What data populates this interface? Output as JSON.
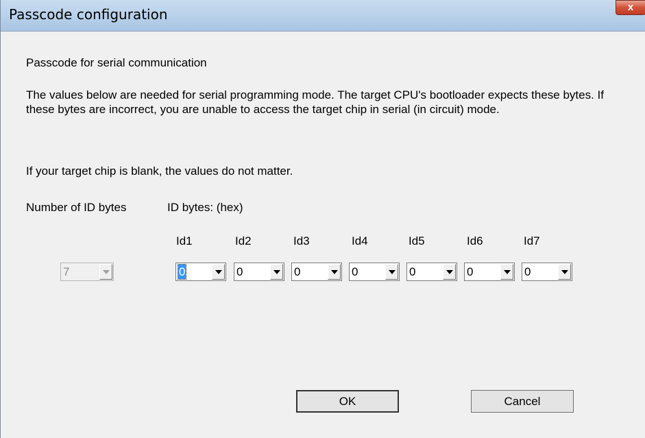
{
  "window": {
    "title": "Passcode configuration",
    "close_label": "x"
  },
  "heading": "Passcode for serial communication",
  "description": "The values below are needed for serial programming mode. The target CPU's bootloader expects these bytes. If these bytes are incorrect, you are unable to access the target chip in serial (in circuit) mode.",
  "note": "If your target chip is blank, the values do not matter.",
  "num_bytes": {
    "label": "Number of ID bytes",
    "value": "7",
    "enabled": false
  },
  "id_bytes": {
    "label": "ID bytes: (hex)",
    "fields": [
      {
        "label": "Id1",
        "value": "0"
      },
      {
        "label": "Id2",
        "value": "0"
      },
      {
        "label": "Id3",
        "value": "0"
      },
      {
        "label": "Id4",
        "value": "0"
      },
      {
        "label": "Id5",
        "value": "0"
      },
      {
        "label": "Id6",
        "value": "0"
      },
      {
        "label": "Id7",
        "value": "0"
      }
    ]
  },
  "buttons": {
    "ok": "OK",
    "cancel": "Cancel"
  }
}
